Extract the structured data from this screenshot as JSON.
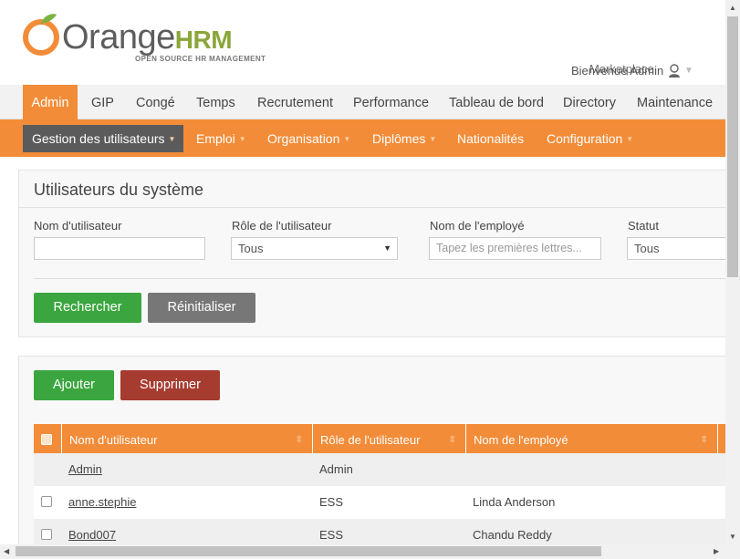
{
  "header": {
    "logo_text": "Orange",
    "logo_hrm": "HRM",
    "logo_tagline": "OPEN SOURCE HR MANAGEMENT",
    "welcome": "Bienvenue Admin",
    "marketplace": "Marketplace"
  },
  "topnav": {
    "items": [
      {
        "label": "Admin"
      },
      {
        "label": "GIP"
      },
      {
        "label": "Congé"
      },
      {
        "label": "Temps"
      },
      {
        "label": "Recrutement"
      },
      {
        "label": "Performance"
      },
      {
        "label": "Tableau de bord"
      },
      {
        "label": "Directory"
      },
      {
        "label": "Maintenance"
      }
    ]
  },
  "subnav": {
    "items": [
      {
        "label": "Gestion des utilisateurs"
      },
      {
        "label": "Emploi"
      },
      {
        "label": "Organisation"
      },
      {
        "label": "Diplômes"
      },
      {
        "label": "Nationalités"
      },
      {
        "label": "Configuration"
      }
    ]
  },
  "search": {
    "title": "Utilisateurs du système",
    "username_label": "Nom d'utilisateur",
    "username_value": "",
    "role_label": "Rôle de l'utilisateur",
    "role_value": "Tous",
    "employee_label": "Nom de l'employé",
    "employee_placeholder": "Tapez les premières lettres...",
    "status_label": "Statut",
    "status_value": "Tous",
    "search_button": "Rechercher",
    "reset_button": "Réinitialiser"
  },
  "list": {
    "add_button": "Ajouter",
    "delete_button": "Supprimer",
    "columns": [
      "Nom d'utilisateur",
      "Rôle de l'utilisateur",
      "Nom de l'employé"
    ],
    "rows": [
      {
        "username": "Admin",
        "role": "Admin",
        "employee": ""
      },
      {
        "username": "anne.stephie",
        "role": "ESS",
        "employee": "Linda Anderson"
      },
      {
        "username": "Bond007",
        "role": "ESS",
        "employee": "Chandu Reddy"
      }
    ]
  },
  "colors": {
    "accent": "#f28c38",
    "green": "#3ba63f",
    "red": "#a63b30",
    "gray": "#777777"
  }
}
